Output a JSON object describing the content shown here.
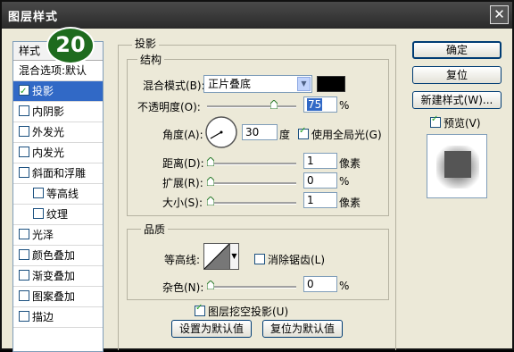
{
  "window": {
    "title": "图层样式",
    "close_glyph": "✕"
  },
  "badge": {
    "text": "20"
  },
  "sidebar": {
    "header": "样式",
    "items": [
      {
        "label": "混合选项:默认",
        "checkbox": false
      },
      {
        "label": "投影",
        "checkbox": true,
        "checked": true,
        "selected": true
      },
      {
        "label": "内阴影",
        "checkbox": true,
        "checked": false
      },
      {
        "label": "外发光",
        "checkbox": true,
        "checked": false
      },
      {
        "label": "内发光",
        "checkbox": true,
        "checked": false
      },
      {
        "label": "斜面和浮雕",
        "checkbox": true,
        "checked": false
      },
      {
        "label": "等高线",
        "checkbox": true,
        "checked": false,
        "indent": true
      },
      {
        "label": "纹理",
        "checkbox": true,
        "checked": false,
        "indent": true
      },
      {
        "label": "光泽",
        "checkbox": true,
        "checked": false
      },
      {
        "label": "颜色叠加",
        "checkbox": true,
        "checked": false
      },
      {
        "label": "渐变叠加",
        "checkbox": true,
        "checked": false
      },
      {
        "label": "图案叠加",
        "checkbox": true,
        "checked": false
      },
      {
        "label": "描边",
        "checkbox": true,
        "checked": false
      }
    ]
  },
  "panel": {
    "title": "投影",
    "structure": {
      "title": "结构",
      "blend_mode_label": "混合模式(B):",
      "blend_mode_value": "正片叠底",
      "blend_color": "#000000",
      "opacity_label": "不透明度(O):",
      "opacity_value": "75",
      "opacity_fraction": 0.75,
      "percent": "%",
      "angle_label": "角度(A):",
      "angle_value": "30",
      "angle_unit": "度",
      "global_light_label": "使用全局光(G)",
      "global_light_checked": true,
      "distance_label": "距离(D):",
      "distance_value": "1",
      "distance_unit": "像素",
      "spread_label": "扩展(R):",
      "spread_value": "0",
      "spread_unit": "%",
      "size_label": "大小(S):",
      "size_value": "1",
      "size_unit": "像素"
    },
    "quality": {
      "title": "品质",
      "contour_label": "等高线:",
      "antialias_label": "消除锯齿(L)",
      "antialias_checked": false,
      "noise_label": "杂色(N):",
      "noise_value": "0",
      "noise_unit": "%"
    },
    "knockout_label": "图层挖空投影(U)",
    "knockout_checked": true,
    "make_default_label": "设置为默认值",
    "reset_default_label": "复位为默认值"
  },
  "right": {
    "ok_label": "确定",
    "reset_label": "复位",
    "new_style_label": "新建样式(W)...",
    "preview_label": "预览(V)",
    "preview_checked": true
  }
}
